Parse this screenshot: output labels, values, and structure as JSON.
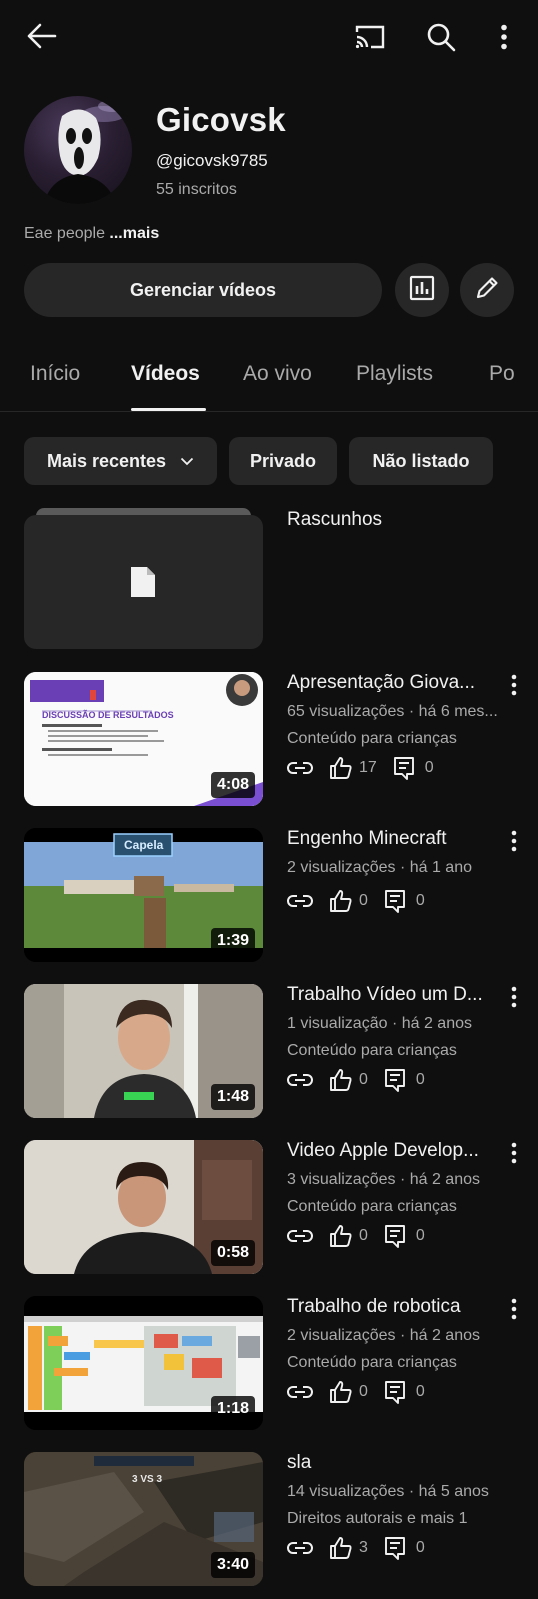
{
  "channel": {
    "name": "Gicovsk",
    "handle": "@gicovsk9785",
    "subscribers": "55 inscritos",
    "description": "Eae people ",
    "description_more": "...mais"
  },
  "actions": {
    "manage_label": "Gerenciar vídeos"
  },
  "tabs": [
    {
      "label": "Início"
    },
    {
      "label": "Vídeos"
    },
    {
      "label": "Ao vivo"
    },
    {
      "label": "Playlists"
    },
    {
      "label": "Po"
    }
  ],
  "filters": [
    {
      "label": "Mais recentes"
    },
    {
      "label": "Privado"
    },
    {
      "label": "Não listado"
    }
  ],
  "drafts": {
    "label": "Rascunhos"
  },
  "videos": [
    {
      "title": "Apresentação Giova...",
      "meta1": "65 visualizações · há 6 mes...",
      "meta2": "Conteúdo para crianças",
      "likes": "17",
      "comments": "0",
      "duration": "4:08"
    },
    {
      "title": "Engenho Minecraft",
      "meta1": "2 visualizações · há 1 ano",
      "meta2": "",
      "likes": "0",
      "comments": "0",
      "duration": "1:39"
    },
    {
      "title": "Trabalho Vídeo um D...",
      "meta1": "1 visualização · há 2 anos",
      "meta2": "Conteúdo para crianças",
      "likes": "0",
      "comments": "0",
      "duration": "1:48"
    },
    {
      "title": "Video Apple Develop...",
      "meta1": "3 visualizações · há 2 anos",
      "meta2": "Conteúdo para crianças",
      "likes": "0",
      "comments": "0",
      "duration": "0:58"
    },
    {
      "title": "Trabalho de robotica",
      "meta1": "2 visualizações · há 2 anos",
      "meta2": "Conteúdo para crianças",
      "likes": "0",
      "comments": "0",
      "duration": "1:18"
    },
    {
      "title": "sla",
      "meta1": "14 visualizações · há 5 anos",
      "meta2": "Direitos autorais e mais 1",
      "likes": "3",
      "comments": "0",
      "duration": "3:40"
    }
  ],
  "thumb_text": {
    "slide_title": "DISCUSSÃO DE RESULTADOS",
    "minecraft_sign": "Capela",
    "game_score": "3 VS 3"
  }
}
